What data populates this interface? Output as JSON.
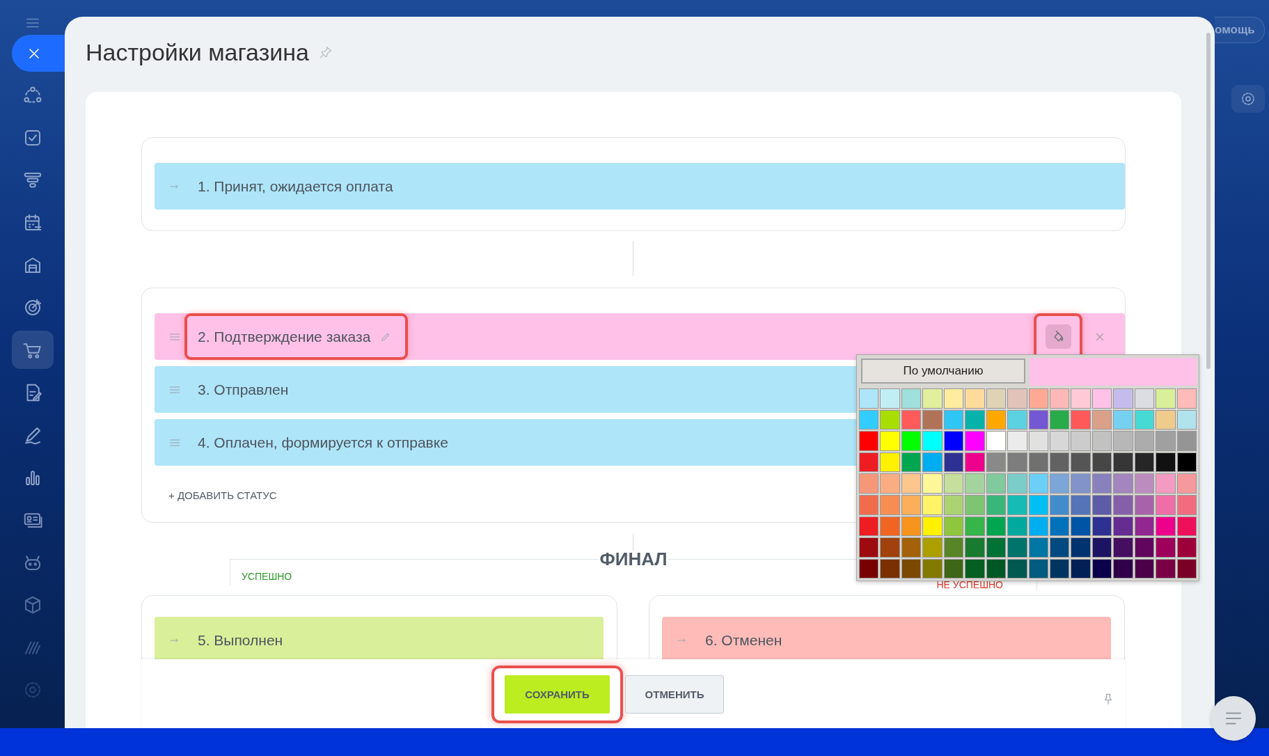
{
  "sidebar": {
    "items": [
      {
        "selected": false
      },
      {
        "selected": false
      },
      {
        "selected": false
      },
      {
        "selected": false
      },
      {
        "selected": false
      },
      {
        "selected": false
      },
      {
        "selected": true
      },
      {
        "selected": false
      },
      {
        "selected": false
      },
      {
        "selected": false
      },
      {
        "selected": false
      },
      {
        "selected": false
      },
      {
        "selected": false
      },
      {
        "selected": false
      },
      {
        "selected": false
      }
    ]
  },
  "help_button": {
    "label": "омощь"
  },
  "panel": {
    "title": "Настройки магазина"
  },
  "initial": {
    "statuses": [
      {
        "label": "1. Принят, ожидается оплата",
        "color": "#aee5f8"
      }
    ]
  },
  "process": {
    "statuses": [
      {
        "label": "2. Подтверждение заказа",
        "color": "#ffc1e7",
        "hovered": true,
        "highlighted": true,
        "color_button_highlighted": true
      },
      {
        "label": "3. Отправлен",
        "color": "#aee5f8",
        "hovered": false,
        "highlighted": false
      },
      {
        "label": "4. Оплачен, формируется к отправке",
        "color": "#aee5f8",
        "hovered": false,
        "highlighted": false
      }
    ],
    "add_button": "+ ДОБАВИТЬ СТАТУС"
  },
  "final": {
    "title": "ФИНАЛ",
    "success": {
      "label": "УСПЕШНО",
      "statuses": [
        {
          "label": "5. Выполнен",
          "color": "#daef9a"
        }
      ]
    },
    "failure": {
      "label": "НЕ УСПЕШНО",
      "statuses": [
        {
          "label": "6. Отменен",
          "color": "#ffbbb8"
        }
      ]
    }
  },
  "palette": {
    "default_button": "По умолчанию",
    "rows": [
      {
        "swatches": [
          {
            "color": "#aee5f8"
          },
          {
            "color": "#c1eef5"
          },
          {
            "color": "#9fe0dc"
          },
          {
            "color": "#e1ef9e"
          },
          {
            "color": "#ffec9e"
          },
          {
            "color": "#ffdb9b"
          },
          {
            "color": "#dfd3b6"
          },
          {
            "color": "#e2c3b9"
          },
          {
            "color": "#ffa994"
          },
          {
            "color": "#ffb8b8"
          },
          {
            "color": "#ffc9d6"
          },
          {
            "color": "#ffc1e7"
          },
          {
            "color": "#c5bced"
          },
          {
            "color": "#dcdde2"
          },
          {
            "color": "#daef9a"
          },
          {
            "color": "#ffbbb8"
          }
        ]
      },
      {
        "swatches": [
          {
            "color": "#33ccff"
          },
          {
            "color": "#a8df00"
          },
          {
            "color": "#ff5b5b"
          },
          {
            "color": "#b07358"
          },
          {
            "color": "#2fc5f5"
          },
          {
            "color": "#06b2aa"
          },
          {
            "color": "#ffa800"
          },
          {
            "color": "#5bd1e1"
          },
          {
            "color": "#7457d2"
          },
          {
            "color": "#29ab4a"
          },
          {
            "color": "#ff5959"
          },
          {
            "color": "#dba089"
          },
          {
            "color": "#76d0ef"
          },
          {
            "color": "#47dad4"
          },
          {
            "color": "#efcb8c"
          },
          {
            "color": "#b1e3ec"
          }
        ]
      },
      {
        "swatches": [
          {
            "color": "#ff0000"
          },
          {
            "color": "#ffff00"
          },
          {
            "color": "#00ff00"
          },
          {
            "color": "#00ffff"
          },
          {
            "color": "#0000ff"
          },
          {
            "color": "#ff00ff"
          },
          {
            "color": "#ffffff"
          },
          {
            "color": "#ebebeb"
          },
          {
            "color": "#e1e1e1"
          },
          {
            "color": "#d7d7d7"
          },
          {
            "color": "#cccccc"
          },
          {
            "color": "#c2c2c2"
          },
          {
            "color": "#b7b7b7"
          },
          {
            "color": "#acacac"
          },
          {
            "color": "#a0a0a0"
          },
          {
            "color": "#959595"
          }
        ]
      },
      {
        "swatches": [
          {
            "color": "#ee1d24"
          },
          {
            "color": "#fff100"
          },
          {
            "color": "#00a650"
          },
          {
            "color": "#00aeef"
          },
          {
            "color": "#2f3192"
          },
          {
            "color": "#ed008c"
          },
          {
            "color": "#898989"
          },
          {
            "color": "#7d7d7d"
          },
          {
            "color": "#707070"
          },
          {
            "color": "#626262"
          },
          {
            "color": "#555555"
          },
          {
            "color": "#464646"
          },
          {
            "color": "#363636"
          },
          {
            "color": "#262626"
          },
          {
            "color": "#111111"
          },
          {
            "color": "#000000"
          }
        ]
      },
      {
        "swatches": [
          {
            "color": "#f7977a"
          },
          {
            "color": "#fbad82"
          },
          {
            "color": "#fdc68c"
          },
          {
            "color": "#fff799"
          },
          {
            "color": "#c6df9c"
          },
          {
            "color": "#a4d49d"
          },
          {
            "color": "#81ca9d"
          },
          {
            "color": "#7bcdc9"
          },
          {
            "color": "#6ccff7"
          },
          {
            "color": "#7ca6d8"
          },
          {
            "color": "#8293ca"
          },
          {
            "color": "#8881be"
          },
          {
            "color": "#a286bd"
          },
          {
            "color": "#bc8cbf"
          },
          {
            "color": "#f49bc1"
          },
          {
            "color": "#f5999d"
          }
        ]
      },
      {
        "swatches": [
          {
            "color": "#f16c4d"
          },
          {
            "color": "#f68e54"
          },
          {
            "color": "#fbaf5a"
          },
          {
            "color": "#fff467"
          },
          {
            "color": "#acd372"
          },
          {
            "color": "#7dc473"
          },
          {
            "color": "#39b778"
          },
          {
            "color": "#16bcb4"
          },
          {
            "color": "#00bff3"
          },
          {
            "color": "#438ccb"
          },
          {
            "color": "#5573b7"
          },
          {
            "color": "#5e5ca7"
          },
          {
            "color": "#855fa8"
          },
          {
            "color": "#a763a9"
          },
          {
            "color": "#ef6ea8"
          },
          {
            "color": "#f16d7e"
          }
        ]
      },
      {
        "swatches": [
          {
            "color": "#ee1d24"
          },
          {
            "color": "#f16522"
          },
          {
            "color": "#f7941d"
          },
          {
            "color": "#fff100"
          },
          {
            "color": "#8fc63d"
          },
          {
            "color": "#37b44a"
          },
          {
            "color": "#00a650"
          },
          {
            "color": "#00a99e"
          },
          {
            "color": "#00aeef"
          },
          {
            "color": "#0072bc"
          },
          {
            "color": "#0054a5"
          },
          {
            "color": "#2f3192"
          },
          {
            "color": "#652c91"
          },
          {
            "color": "#91278f"
          },
          {
            "color": "#ed008c"
          },
          {
            "color": "#ee105a"
          }
        ]
      },
      {
        "swatches": [
          {
            "color": "#9d0a0f"
          },
          {
            "color": "#a1410d"
          },
          {
            "color": "#a36209"
          },
          {
            "color": "#aba000"
          },
          {
            "color": "#588528"
          },
          {
            "color": "#197b30"
          },
          {
            "color": "#007236"
          },
          {
            "color": "#00736a"
          },
          {
            "color": "#0076a4"
          },
          {
            "color": "#004a80"
          },
          {
            "color": "#003370"
          },
          {
            "color": "#1d1363"
          },
          {
            "color": "#450e61"
          },
          {
            "color": "#62055f"
          },
          {
            "color": "#9e005c"
          },
          {
            "color": "#9d0039"
          }
        ]
      },
      {
        "swatches": [
          {
            "color": "#790000"
          },
          {
            "color": "#7b3000"
          },
          {
            "color": "#7c4900"
          },
          {
            "color": "#827a00"
          },
          {
            "color": "#3e6617"
          },
          {
            "color": "#045f20"
          },
          {
            "color": "#005824"
          },
          {
            "color": "#005951"
          },
          {
            "color": "#005b7e"
          },
          {
            "color": "#003562"
          },
          {
            "color": "#002056"
          },
          {
            "color": "#0c004b"
          },
          {
            "color": "#30004a"
          },
          {
            "color": "#4b0048"
          },
          {
            "color": "#7a0045"
          },
          {
            "color": "#7a0026"
          }
        ]
      }
    ]
  },
  "footer": {
    "save": {
      "label": "СОХРАНИТЬ",
      "highlighted": true
    },
    "cancel": {
      "label": "ОТМЕНИТЬ"
    }
  }
}
